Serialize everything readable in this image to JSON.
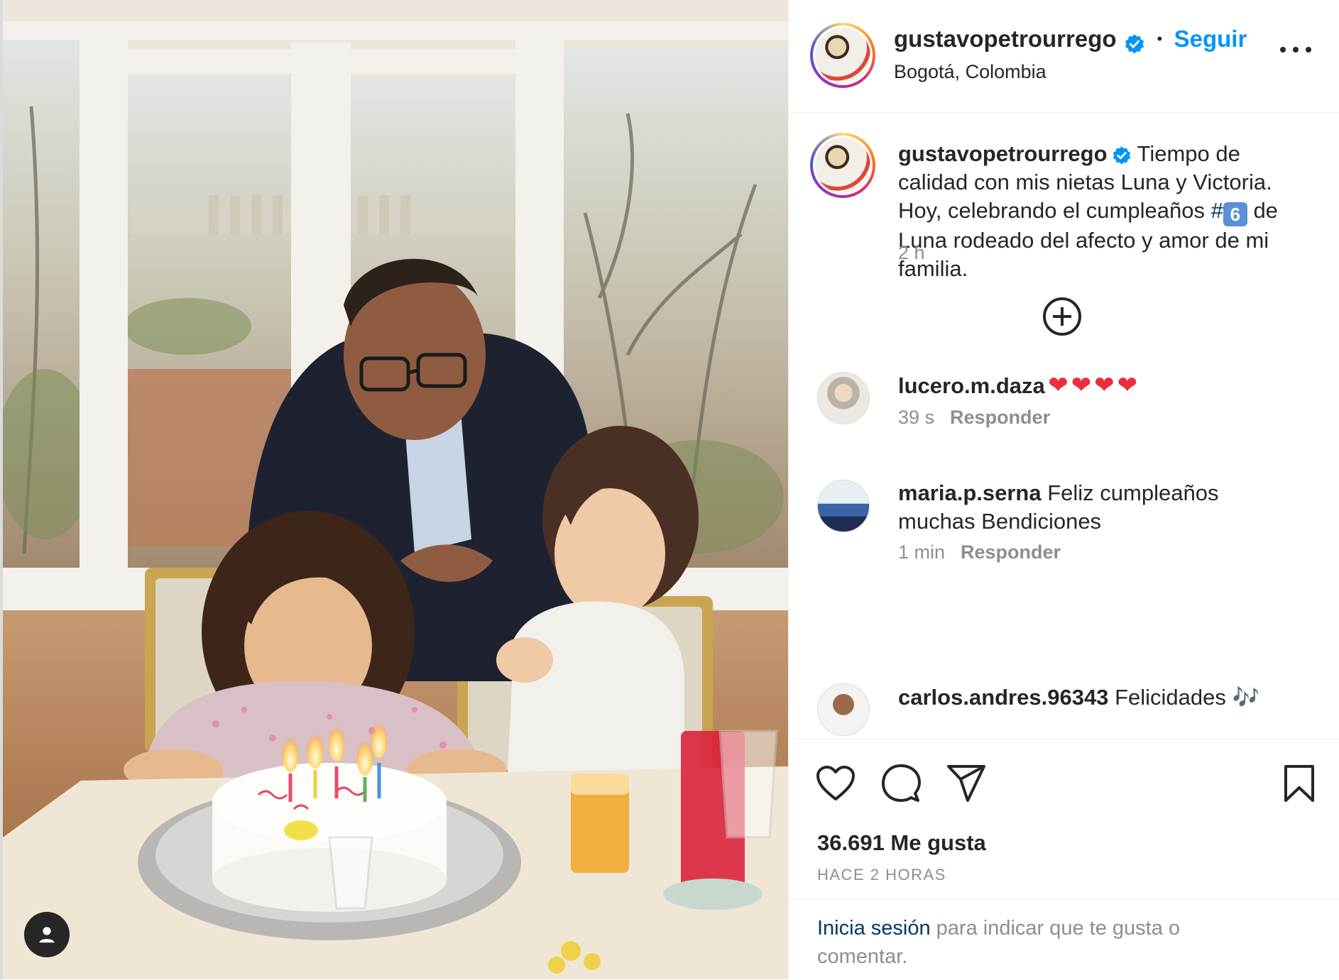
{
  "post": {
    "username": "gustavopetrourrego",
    "follow_label": "Seguir",
    "separator": "•",
    "location": "Bogotá, Colombia"
  },
  "caption": {
    "username": "gustavopetrourrego",
    "text_before": "Tiempo de calidad con mis nietas Luna y Victoria. Hoy, celebrando el cumpleaños ",
    "hashtag_symbol": "#",
    "keycap": "6",
    "text_after": " de Luna rodeado del afecto y amor de mi familia.",
    "time": "2 h"
  },
  "comments": [
    {
      "username": "lucero.m.daza",
      "text": "❤❤❤❤",
      "time": "39 s",
      "reply_label": "Responder"
    },
    {
      "username": "maria.p.serna",
      "text": "Feliz cumpleaños muchas Bendiciones",
      "time": "1 min",
      "reply_label": "Responder"
    },
    {
      "username": "carlos.andres.96343",
      "text": "Felicidades 🎶",
      "time": "",
      "reply_label": ""
    }
  ],
  "stats": {
    "likes": "36.691 Me gusta",
    "time_ago": "HACE 2 HORAS"
  },
  "login_prompt": {
    "link": "Inicia sesión",
    "text": " para indicar que te gusta o comentar."
  },
  "colors": {
    "accent": "#0095f6",
    "text": "#262626",
    "muted": "#8e8e8e",
    "heart": "#ed2c3c"
  },
  "icons": [
    "verified-badge-icon",
    "more-options-icon",
    "load-more-plus-icon",
    "like-heart-icon",
    "comment-icon",
    "share-icon",
    "save-bookmark-icon",
    "user-tag-icon"
  ]
}
